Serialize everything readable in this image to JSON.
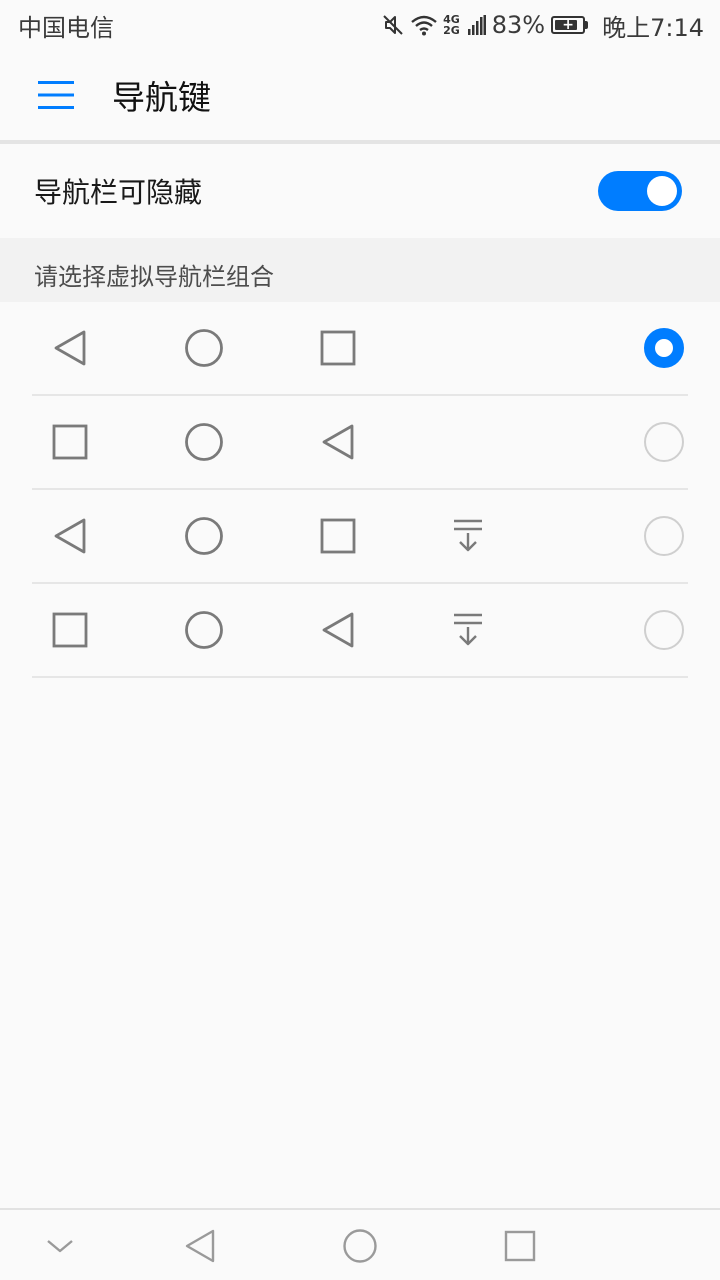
{
  "status_bar": {
    "carrier": "中国电信",
    "network_top": "4G",
    "network_bottom": "2G",
    "battery_percent": "83%",
    "time": "晚上7:14"
  },
  "app_bar": {
    "title": "导航键",
    "menu_icon": "menu-icon"
  },
  "hide_toggle": {
    "label": "导航栏可隐藏",
    "enabled": true
  },
  "section": {
    "header": "请选择虚拟导航栏组合"
  },
  "options": [
    {
      "keys": [
        "back",
        "home",
        "recent"
      ],
      "selected": true
    },
    {
      "keys": [
        "recent",
        "home",
        "back"
      ],
      "selected": false
    },
    {
      "keys": [
        "back",
        "home",
        "recent",
        "notification"
      ],
      "selected": false
    },
    {
      "keys": [
        "recent",
        "home",
        "back",
        "notification"
      ],
      "selected": false
    }
  ],
  "colors": {
    "accent": "#007dff",
    "icon_gray": "#7a7a7a"
  }
}
